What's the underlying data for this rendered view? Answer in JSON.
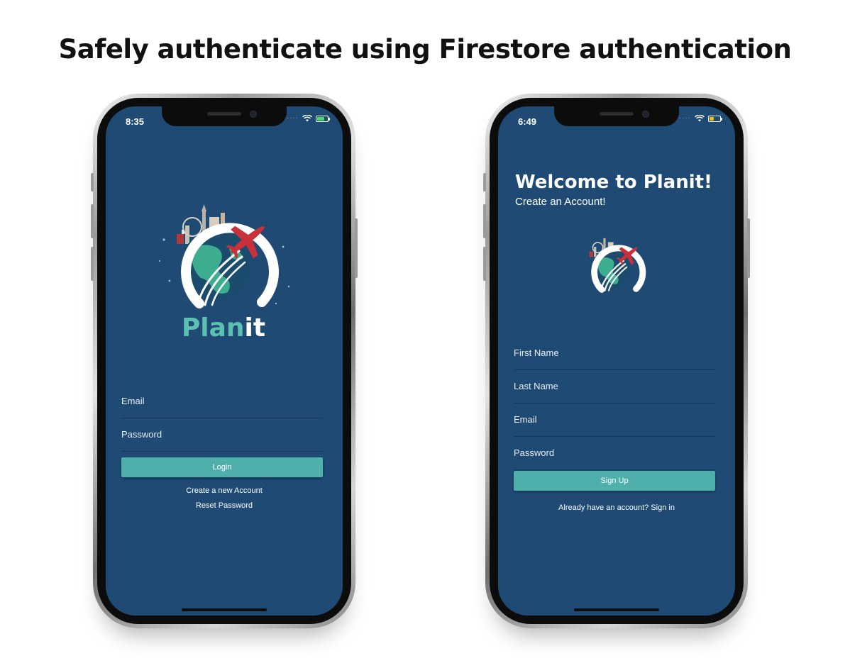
{
  "headline": "Safely authenticate using Firestore authentication",
  "login_screen": {
    "status": {
      "time": "8:35",
      "battery_color": "#4cd964"
    },
    "logo": {
      "brand_part1": "Plan",
      "brand_part2": "it"
    },
    "fields": [
      {
        "label": "Email"
      },
      {
        "label": "Password"
      }
    ],
    "login_button": "Login",
    "create_account_link": "Create a new Account",
    "reset_password_link": "Reset Password"
  },
  "signup_screen": {
    "status": {
      "time": "6:49",
      "battery_color": "#f5c400"
    },
    "title": "Welcome to Planit!",
    "subtitle": "Create an Account!",
    "fields": [
      {
        "label": "First Name"
      },
      {
        "label": "Last Name"
      },
      {
        "label": "Email"
      },
      {
        "label": "Password"
      }
    ],
    "signup_button": "Sign Up",
    "signin_link": "Already have an account? Sign in"
  },
  "colors": {
    "screen_bg": "#1e4a74",
    "button": "#4fb0ab",
    "brand_teal": "#5cc0b3",
    "plane_red": "#c8303a"
  },
  "icons": [
    "wifi-icon",
    "battery-icon",
    "globe-icon",
    "airplane-icon",
    "camera-icon"
  ]
}
